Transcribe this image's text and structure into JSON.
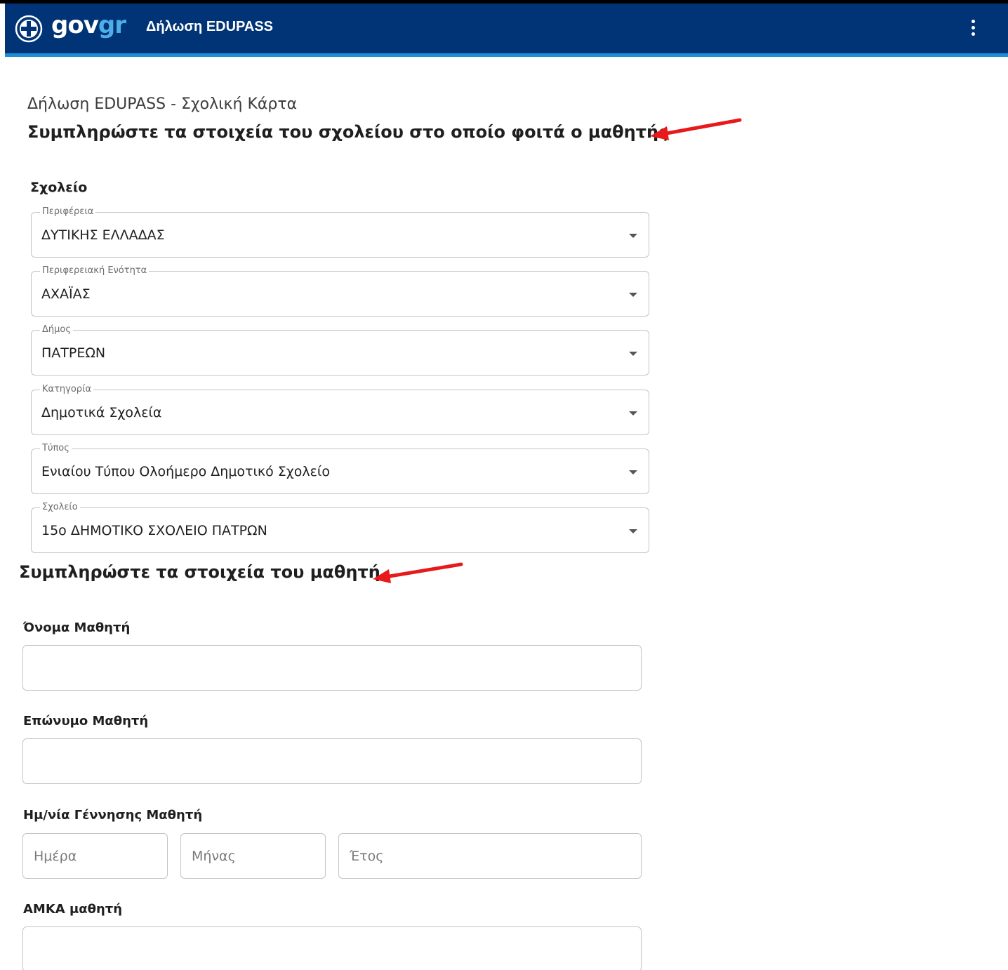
{
  "header": {
    "brand_gov": "gov",
    "brand_gr": "gr",
    "title": "Δήλωση EDUPASS"
  },
  "page": {
    "breadcrumb": "Δήλωση EDUPASS - Σχολική Κάρτα",
    "school_heading": "Συμπληρώστε τα στοιχεία του σχολείου στο οποίο φοιτά ο μαθητής",
    "student_heading": "Συμπληρώστε τα στοιχεία του μαθητή"
  },
  "school": {
    "section_label": "Σχολείο",
    "fields": [
      {
        "label": "Περιφέρεια",
        "value": "ΔΥΤΙΚΗΣ ΕΛΛΑΔΑΣ"
      },
      {
        "label": "Περιφερειακή Ενότητα",
        "value": "ΑΧΑΪΑΣ"
      },
      {
        "label": "Δήμος",
        "value": "ΠΑΤΡΕΩΝ"
      },
      {
        "label": "Κατηγορία",
        "value": "Δημοτικά Σχολεία"
      },
      {
        "label": "Τύπος",
        "value": "Ενιαίου Τύπου Ολοήμερο Δημοτικό Σχολείο"
      },
      {
        "label": "Σχολείο",
        "value": "15ο ΔΗΜΟΤΙΚΟ ΣΧΟΛΕΙΟ ΠΑΤΡΩΝ"
      }
    ]
  },
  "student": {
    "first_name_label": "Όνομα Μαθητή",
    "first_name_value": "",
    "last_name_label": "Επώνυμο Μαθητή",
    "last_name_value": "",
    "birthdate_label": "Ημ/νία Γέννησης Μαθητή",
    "day_placeholder": "Ημέρα",
    "month_placeholder": "Μήνας",
    "year_placeholder": "Έτος",
    "amka_label": "ΑΜΚΑ μαθητή",
    "amka_value": ""
  },
  "colors": {
    "appbar": "#003476",
    "appbar_accent": "#1e8fd6",
    "annotation_arrow": "#e8191a"
  }
}
